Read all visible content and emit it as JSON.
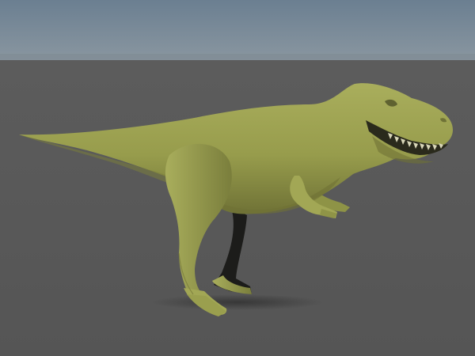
{
  "scene": {
    "subject": "t-rex-model",
    "colors": {
      "sky_top": "#6b7f91",
      "sky_bottom": "#8996a0",
      "horizon_haze": "#7e8a92",
      "ground_far": "#5c5c5c",
      "ground_near": "#555555",
      "skin_light": "#a9ae5c",
      "skin_mid": "#979c4c",
      "skin_dark": "#6f7236",
      "shadow": "#1e1e1e",
      "teeth": "#d8d6b8"
    }
  }
}
